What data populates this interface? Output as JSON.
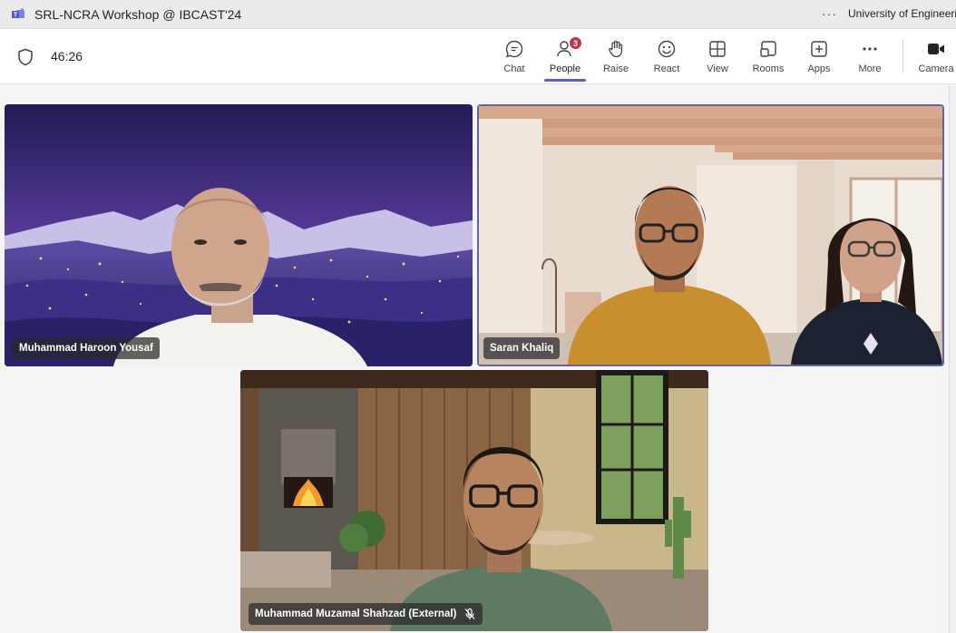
{
  "window": {
    "title": "SRL-NCRA Workshop @ IBCAST'24",
    "org": "University of Engineeri",
    "more_dots": "···"
  },
  "meeting": {
    "timer": "46:26"
  },
  "toolbar": {
    "chat": "Chat",
    "people": "People",
    "people_count": "3",
    "raise": "Raise",
    "react": "React",
    "view": "View",
    "rooms": "Rooms",
    "apps": "Apps",
    "more": "More",
    "camera": "Camera"
  },
  "participants": {
    "p1": "Muhammad Haroon Yousaf",
    "p2": "Saran Khaliq",
    "p3": "Muhammad Muzamal Shahzad (External)"
  },
  "colors": {
    "accent": "#5b5fc7",
    "badge": "#c4314b"
  },
  "icons": [
    "teams-icon",
    "shield-icon",
    "chat-icon",
    "people-icon",
    "raise-hand-icon",
    "react-icon",
    "view-icon",
    "rooms-icon",
    "apps-icon",
    "more-icon",
    "camera-icon",
    "mic-off-icon"
  ]
}
